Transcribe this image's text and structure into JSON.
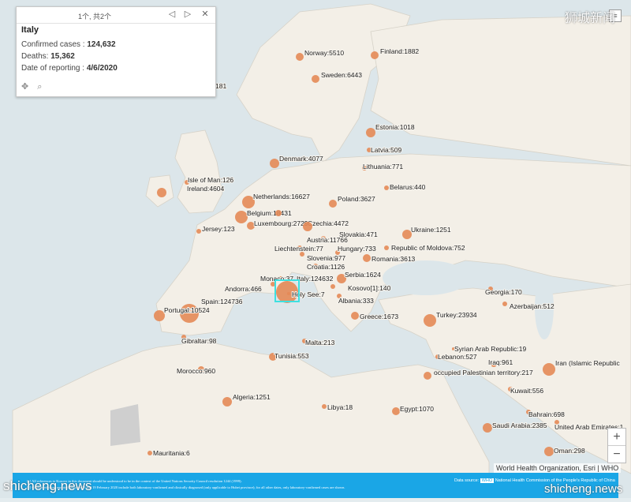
{
  "popup": {
    "pager": "1个, 共2个",
    "title": "Italy",
    "confirmed_label": "Confirmed cases : ",
    "confirmed_value": "124,632",
    "deaths_label": "Deaths: ",
    "deaths_value": "15,362",
    "date_label": "Date of reporting : ",
    "date_value": "4/6/2020",
    "prev_icon": "triangle-left",
    "next_icon": "triangle-right",
    "close_icon": "cross"
  },
  "attribution": "World Health Organization, Esri | WHO",
  "zoom": {
    "in": "+",
    "out": "−"
  },
  "footer": {
    "left_line1": "[1] All references to Kosovo in this document should be understood to be in the context of the United Nations Security Council resolution 1244 (1999).",
    "left_line2": "[2] Confirmed cases reported between 13 and 19 February 2020 include both laboratory-confirmed and clinically diagnosed (only applicable to Hubei province); for all other dates, only laboratory-confirmed cases are shown.",
    "right_label": "Data source:",
    "right_badge": "WHO",
    "right_text": "National Health Commission of the People's Republic of China"
  },
  "watermarks": {
    "top": "狮城新闻",
    "bottom_left": "shicheng.news",
    "bottom_right": "shicheng.news"
  },
  "colors": {
    "sea": "#dce6ea",
    "land": "#f3efe7",
    "marker": "#e48a56",
    "highlight": "#3ee0e0",
    "footer": "#1aa6e6"
  },
  "labels": [
    "Norway:5510",
    "Finland:1882",
    "Sweden:6443",
    "181",
    "Estonia:1018",
    "Latvia:509",
    "Denmark:4077",
    "Lithuania:771",
    "Isle of Man:126",
    "Ireland:4604",
    "Belarus:440",
    "Netherlands:16627",
    "Poland:3627",
    "Belgium:18431",
    "Luxembourg:2729",
    "Czechia:4472",
    "Jersey:123",
    "Slovakia:471",
    "Ukraine:1251",
    "Austria:11766",
    "Liechtenstein:77",
    "Hungary:733",
    "Republic of Moldova:752",
    "Slovenia:977",
    "Romania:3613",
    "Croatia:1126",
    "Serbia:1624",
    "Monaco:37",
    "Italy:124632",
    "Andorra:466",
    "Kosovo[1]:140",
    "Holy See:7",
    "Georgia:170",
    "Albania:333",
    "Spain:124736",
    "Azerbaijan:512",
    "Portugal:10524",
    "Greece:1673",
    "Turkey:23934",
    "Gibraltar:98",
    "Malta:213",
    "Syrian Arab Republic:19",
    "Tunisia:553",
    "Lebanon:527",
    "Iraq:961",
    "Iran (Islamic Republic",
    "Morocco:960",
    "occupied Palestinian territory:217",
    "Kuwait:556",
    "Algeria:1251",
    "Libya:18",
    "Egypt:1070",
    "Bahrain:698",
    "Saudi Arabia:2385",
    "United Arab Emirates:1",
    "Oman:298",
    "Mauritania:6"
  ]
}
